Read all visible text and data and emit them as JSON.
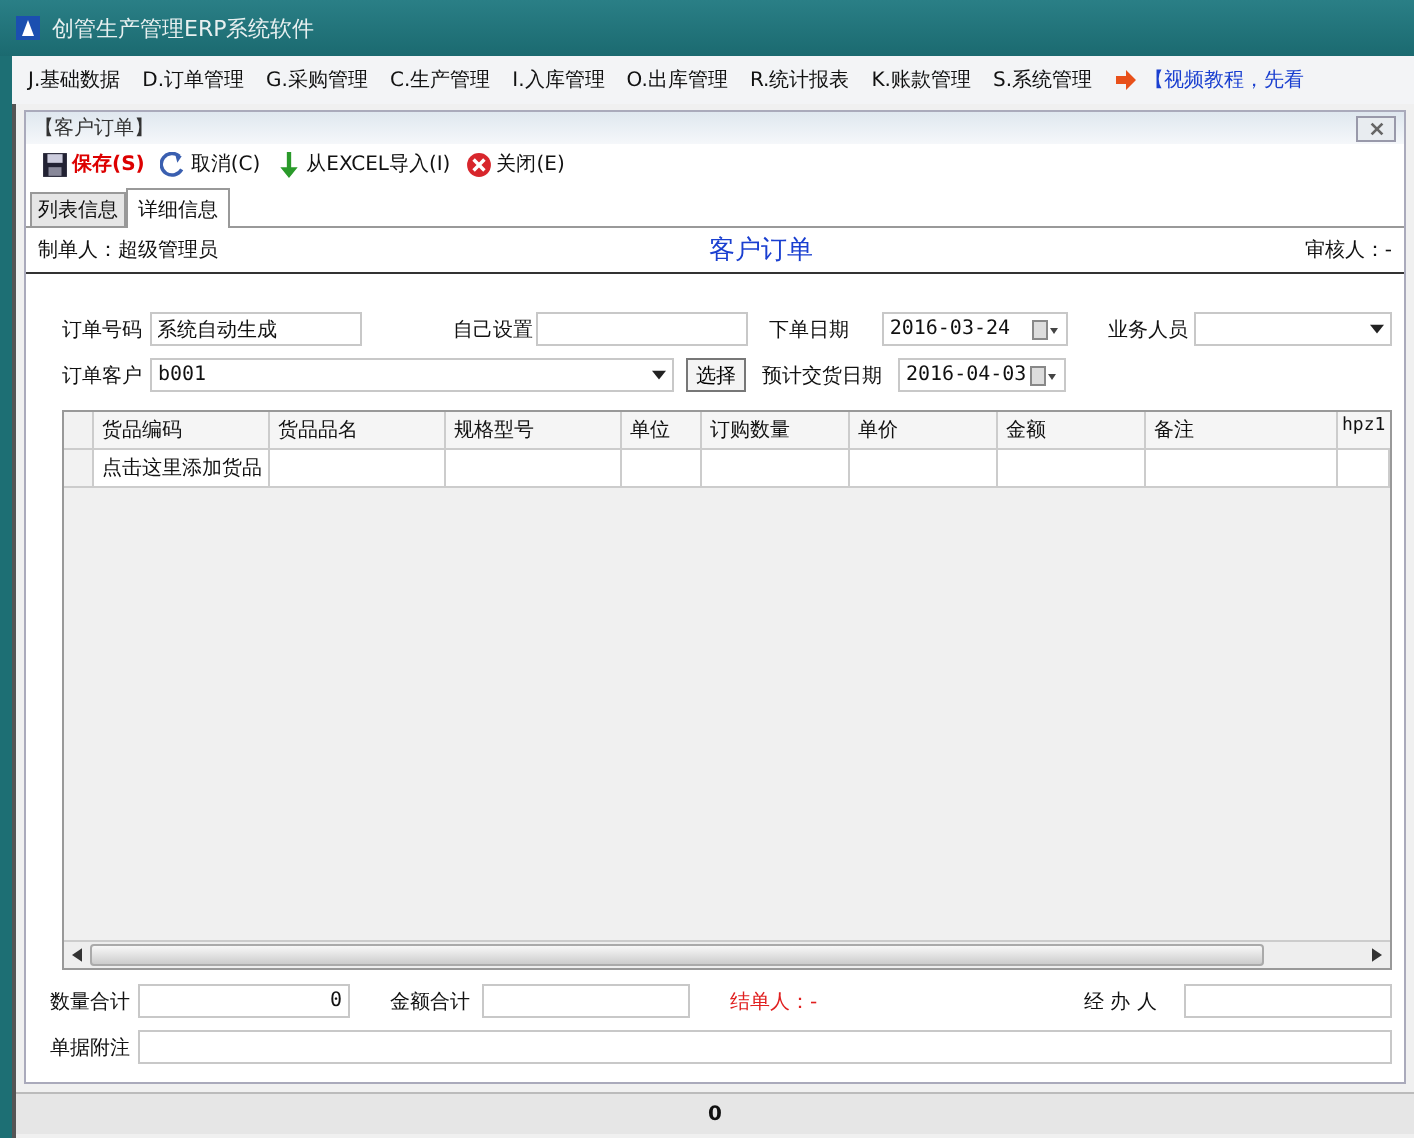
{
  "window": {
    "title": "创管生产管理ERP系统软件"
  },
  "menu": [
    "J.基础数据",
    "D.订单管理",
    "G.采购管理",
    "C.生产管理",
    "I.入库管理",
    "O.出库管理",
    "R.统计报表",
    "K.账款管理",
    "S.系统管理"
  ],
  "menu_link": "【视频教程，先看",
  "panel": {
    "title": "【客户订单】"
  },
  "toolbar": [
    {
      "label": "保存(S)",
      "kind": "save"
    },
    {
      "label": "取消(C)",
      "kind": "cancel"
    },
    {
      "label": "从EXCEL导入(I)",
      "kind": "import"
    },
    {
      "label": "关闭(E)",
      "kind": "close"
    }
  ],
  "tabs": [
    {
      "label": "列表信息",
      "selected": false
    },
    {
      "label": "详细信息",
      "selected": true
    }
  ],
  "header": {
    "creator": "制单人：超级管理员",
    "title": "客户订单",
    "reviewer": "审核人：-"
  },
  "form": {
    "order_no_label": "订单号码",
    "order_no": "系统自动生成",
    "custom_label": "自己设置",
    "order_date_label": "下单日期",
    "order_date": "2016-03-24",
    "salesperson_label": "业务人员",
    "customer_label": "订单客户",
    "customer": "b001",
    "choose_button": "选择",
    "delivery_label": "预计交货日期",
    "delivery_date": "2016-04-03"
  },
  "table": {
    "columns": [
      "货品编码",
      "货品品名",
      "规格型号",
      "单位",
      "订购数量",
      "单价",
      "金额",
      "备注",
      "hpz1"
    ],
    "rows": [
      [
        "点击这里添加货品",
        "",
        "",
        "",
        "",
        "",
        "",
        "",
        ""
      ]
    ]
  },
  "footer": {
    "qty_label": "数量合计",
    "qty": "0",
    "amount_label": "金额合计",
    "closer": "结单人：-",
    "handler_label": "经 办 人",
    "note_label": "单据附注"
  },
  "status_bar": "0"
}
